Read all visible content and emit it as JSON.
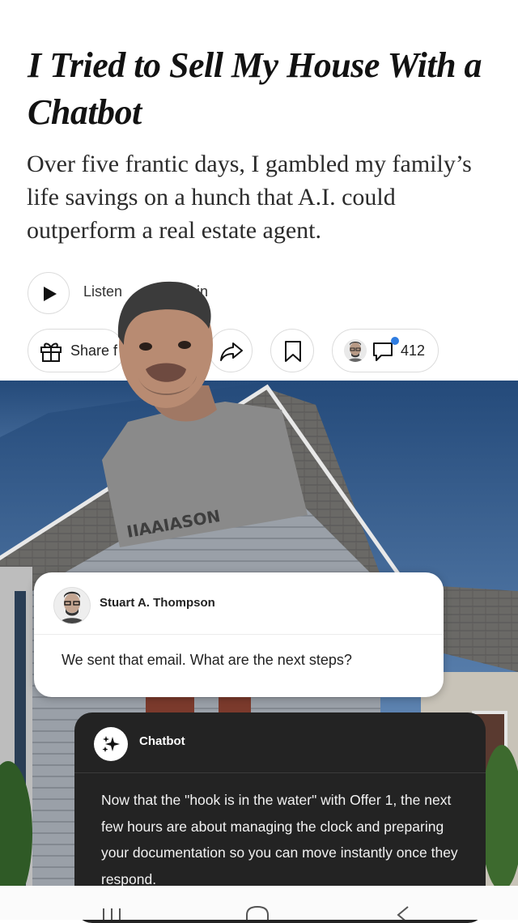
{
  "article": {
    "headline": "I Tried to Sell My House With a Chatbot",
    "summary": "Over five frantic days, I gambled my family’s life savings on a hunch that A.I. could outperform a real estate agent."
  },
  "audio": {
    "listen_label": "Listen",
    "time_label": "min"
  },
  "actions": {
    "gift_label": "Share f",
    "comment_count": "412"
  },
  "icons": [
    "play-icon",
    "gift-icon",
    "share-icon",
    "bookmark-icon",
    "comment-icon",
    "sparkle-icon",
    "recent-apps-icon",
    "home-icon",
    "back-icon"
  ],
  "chat": {
    "user": {
      "name": "Stuart A. Thompson",
      "message": "We sent that email. What are the next steps?"
    },
    "bot": {
      "name": "Chatbot",
      "message": "Now that the \"hook is in the water\" with Offer 1, the next few hours are about managing the clock and preparing your documentation so you can move instantly once they respond."
    }
  },
  "colors": {
    "notification_dot": "#2f7de1",
    "bot_card": "#232323",
    "sky": "#5a86b8"
  }
}
